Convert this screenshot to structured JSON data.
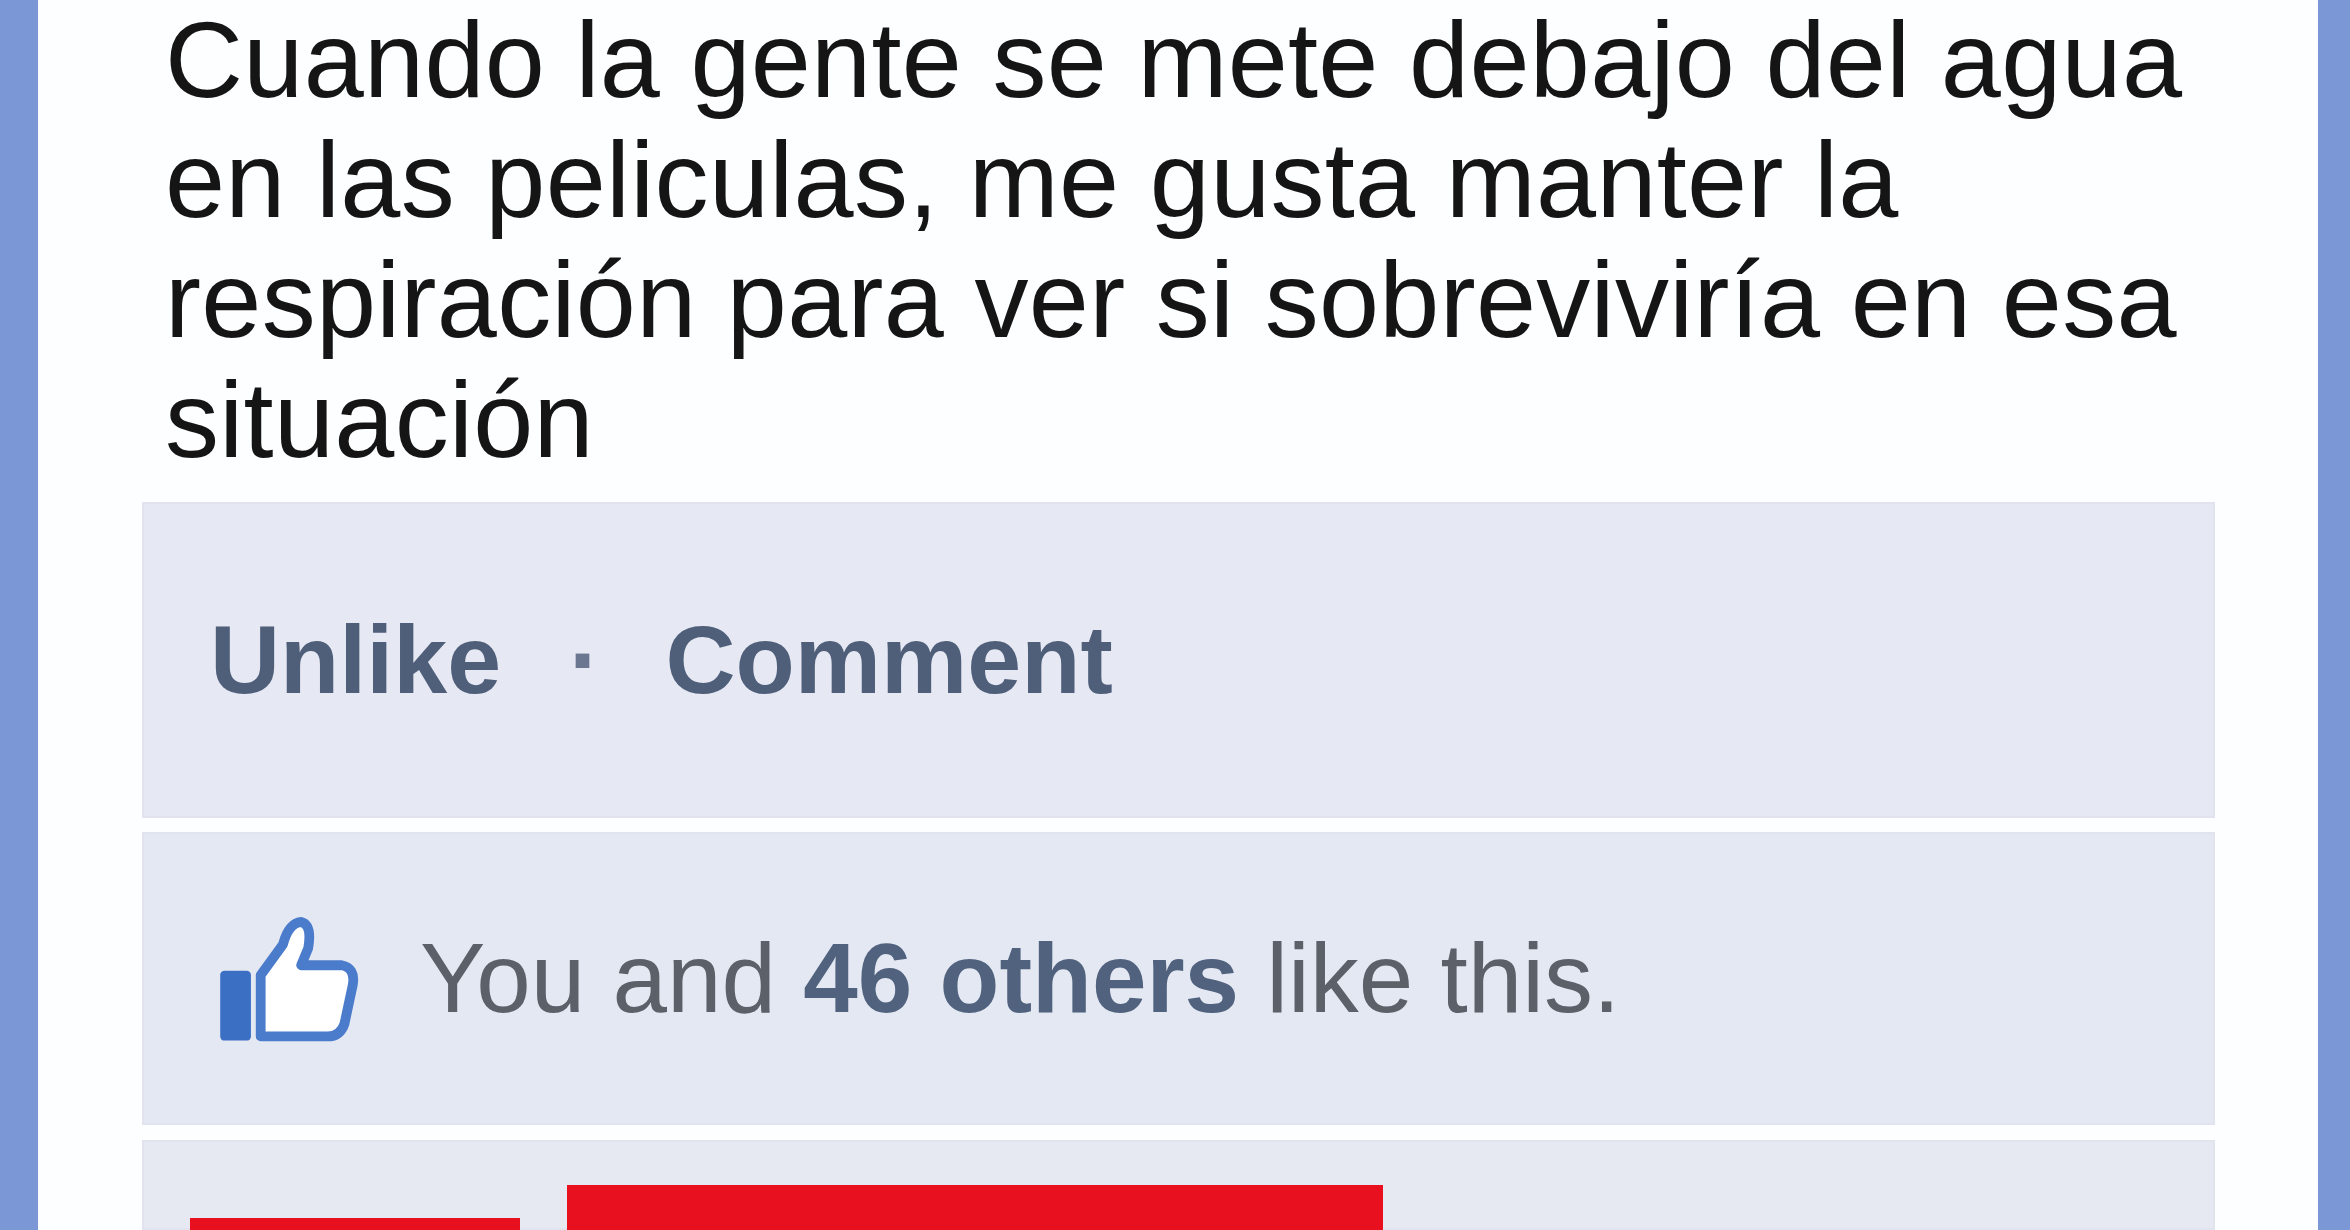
{
  "post": {
    "text": "Cuando la gente se mete debajo del agua en las peliculas, me gusta manter la respiración para ver si sobreviviría en esa situación"
  },
  "actions": {
    "items": [
      {
        "label": "Unlike"
      },
      {
        "label": "Comment"
      }
    ],
    "separator": "·"
  },
  "likes": {
    "text": "You and **46 others** like this."
  }
}
